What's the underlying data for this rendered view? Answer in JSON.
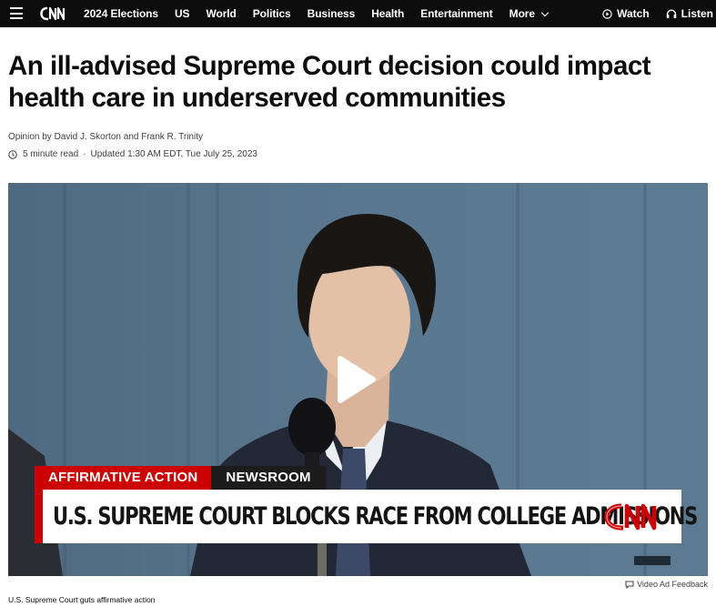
{
  "nav": {
    "links": [
      "2024 Elections",
      "US",
      "World",
      "Politics",
      "Business",
      "Health",
      "Entertainment"
    ],
    "more_label": "More",
    "watch_label": "Watch",
    "listen_label": "Listen",
    "logo_text": "CNN"
  },
  "article": {
    "headline": "An ill-advised Supreme Court decision could impact health care in underserved communities",
    "byline_prefix": "Opinion by",
    "authors": "David J. Skorton and Frank R. Trinity",
    "read_time": "5 minute read",
    "updated": "Updated 1:30 AM EDT, Tue July 25, 2023"
  },
  "video": {
    "chyron_tag": "AFFIRMATIVE ACTION",
    "chyron_show": "NEWSROOM",
    "chyron_headline": "U.S. SUPREME COURT BLOCKS RACE FROM COLLEGE ADMISSIONS",
    "chyron_logo": "CNN",
    "ad_feedback": "Video Ad Feedback",
    "caption": "U.S. Supreme Court guts affirmative action"
  },
  "colors": {
    "nav_bg": "#0c0c0c",
    "brand_red": "#cc0000",
    "text": "#0c0c0c",
    "muted": "#404040"
  },
  "icons": [
    "menu-icon",
    "cnn-logo",
    "chevron-down-icon",
    "play-circle-icon",
    "headphones-icon",
    "clock-icon",
    "play-icon",
    "feedback-icon"
  ]
}
